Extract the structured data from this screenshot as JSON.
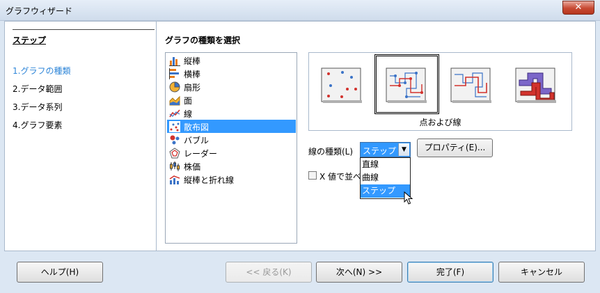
{
  "window": {
    "title": "グラフウィザード",
    "close_glyph": "✕"
  },
  "steps": {
    "heading": "ステップ",
    "items": [
      {
        "label": "1.グラフの種類",
        "active": true
      },
      {
        "label": "2.データ範囲",
        "active": false
      },
      {
        "label": "3.データ系列",
        "active": false
      },
      {
        "label": "4.グラフ要素",
        "active": false
      }
    ]
  },
  "chart_type": {
    "heading": "グラフの種類を選択",
    "items": [
      {
        "label": "縦棒",
        "icon": "column-chart-icon"
      },
      {
        "label": "横棒",
        "icon": "bar-chart-icon"
      },
      {
        "label": "扇形",
        "icon": "pie-chart-icon"
      },
      {
        "label": "面",
        "icon": "area-chart-icon"
      },
      {
        "label": "線",
        "icon": "line-chart-icon"
      },
      {
        "label": "散布図",
        "icon": "scatter-chart-icon",
        "selected": true
      },
      {
        "label": "バブル",
        "icon": "bubble-chart-icon"
      },
      {
        "label": "レーダー",
        "icon": "radar-chart-icon"
      },
      {
        "label": "株価",
        "icon": "stock-chart-icon"
      },
      {
        "label": "縦棒と折れ線",
        "icon": "column-line-chart-icon"
      }
    ]
  },
  "variants": {
    "caption": "点および線",
    "items": [
      {
        "name": "points-only"
      },
      {
        "name": "points-and-lines",
        "selected": true
      },
      {
        "name": "lines-only"
      },
      {
        "name": "3d-lines"
      }
    ]
  },
  "line_type": {
    "label": "線の種類(L)",
    "selected": "ステップ",
    "options": [
      "直線",
      "曲線",
      "ステップ"
    ],
    "highlighted": "ステップ"
  },
  "properties_button": "プロパティ(E)...",
  "sort_checkbox": {
    "label": "X 値で並べ替え",
    "checked": false
  },
  "buttons": {
    "help": "ヘルプ(H)",
    "back": "<< 戻る(K)",
    "next": "次へ(N) >>",
    "finish": "完了(F)",
    "cancel": "キャンセル"
  },
  "colors": {
    "accent": "#3399ff",
    "active_step": "#2f86d8",
    "close_button": "#c74a33"
  }
}
